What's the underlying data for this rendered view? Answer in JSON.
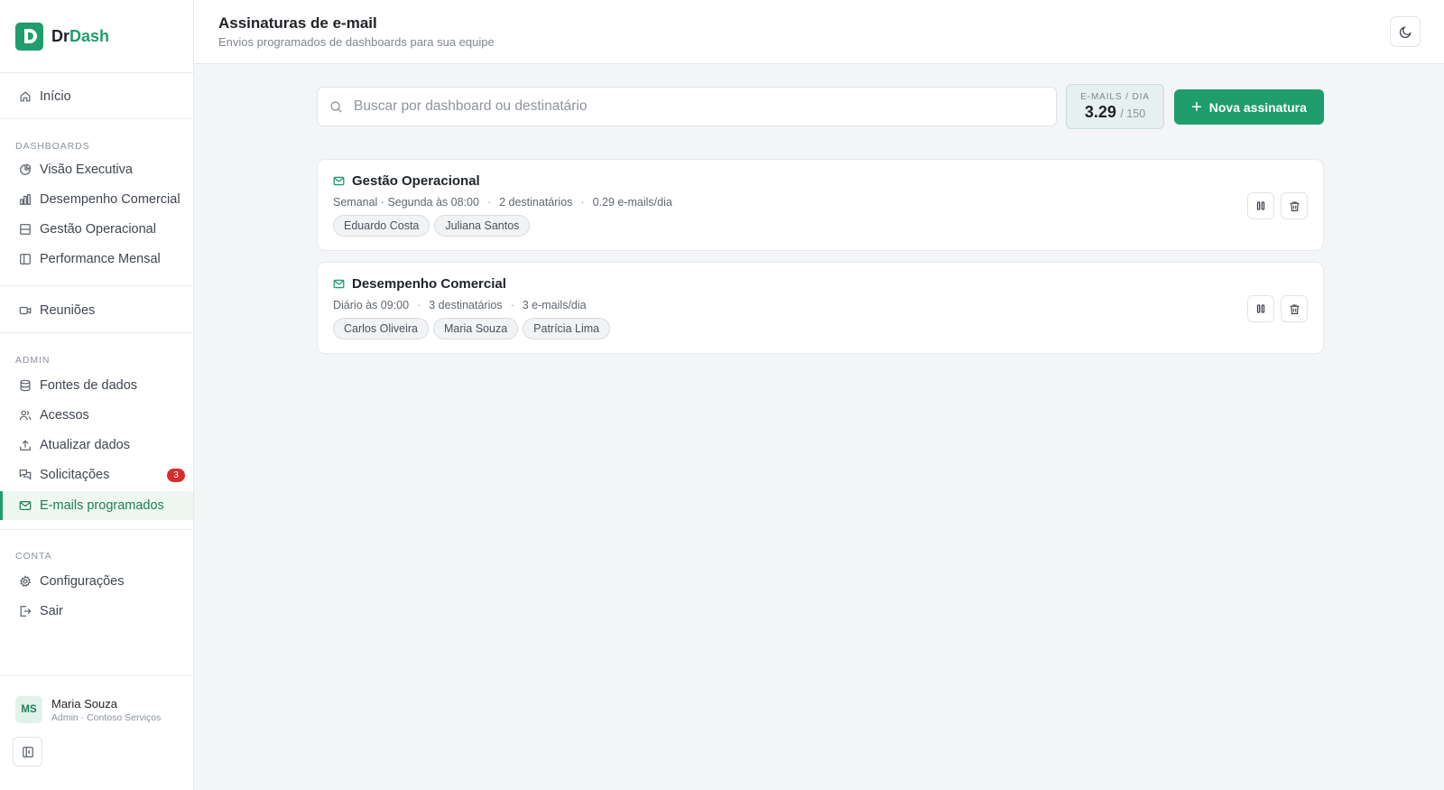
{
  "brand": {
    "prefix": "Dr",
    "accent": "Dash",
    "logo_letter": "D",
    "color": "#1f9d6d"
  },
  "sidebar": {
    "home": "Início",
    "sections": {
      "dashboards": "DASHBOARDS",
      "admin": "ADMIN",
      "account": "CONTA"
    },
    "dashboards": [
      "Visão Executiva",
      "Desempenho Comercial",
      "Gestão Operacional",
      "Performance Mensal"
    ],
    "meetings": "Reuniões",
    "admin": {
      "data_sources": "Fontes de dados",
      "access": "Acessos",
      "update_data": "Atualizar dados",
      "requests": "Solicitações",
      "requests_badge": "3",
      "scheduled_emails": "E-mails programados"
    },
    "account": {
      "settings": "Configurações",
      "logout": "Sair"
    },
    "user": {
      "initials": "MS",
      "name": "Maria Souza",
      "role": "Admin · Contoso Serviços"
    }
  },
  "header": {
    "title": "Assinaturas de e-mail",
    "subtitle": "Envios programados de dashboards para sua equipe"
  },
  "search": {
    "placeholder": "Buscar por dashboard ou destinatário",
    "value": ""
  },
  "quota": {
    "label": "E-MAILS / DIA",
    "value": "3.29",
    "max": "/ 150"
  },
  "new_button": {
    "label": "Nova assinatura"
  },
  "subscriptions": [
    {
      "title": "Gestão Operacional",
      "schedule": "Semanal · Segunda às 08:00",
      "recipients_count": "2 destinatários",
      "rate": "0.29 e-mails/dia",
      "recipients": [
        "Eduardo Costa",
        "Juliana Santos"
      ]
    },
    {
      "title": "Desempenho Comercial",
      "schedule": "Diário às 09:00",
      "recipients_count": "3 destinatários",
      "rate": "3 e-mails/dia",
      "recipients": [
        "Carlos Oliveira",
        "Maria Souza",
        "Patrícia Lima"
      ]
    }
  ]
}
